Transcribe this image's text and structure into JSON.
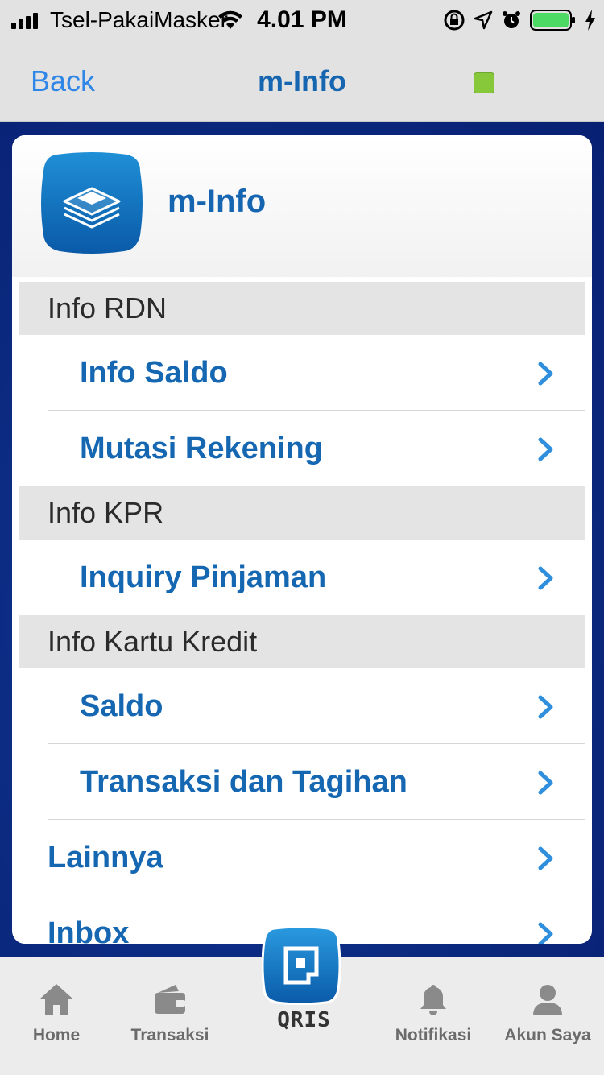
{
  "status_bar": {
    "carrier": "Tsel-PakaiMasker",
    "time": "4.01 PM"
  },
  "nav": {
    "back_label": "Back",
    "title": "m-Info",
    "indicator_color": "#86c83a"
  },
  "card": {
    "icon": "document-stack-icon",
    "title": "m-Info"
  },
  "sections": [
    {
      "header": "Info RDN",
      "items": [
        {
          "label": "Info Saldo"
        },
        {
          "label": "Mutasi Rekening"
        }
      ]
    },
    {
      "header": "Info KPR",
      "items": [
        {
          "label": "Inquiry Pinjaman"
        }
      ]
    },
    {
      "header": "Info Kartu Kredit",
      "items": [
        {
          "label": "Saldo"
        },
        {
          "label": "Transaksi dan Tagihan"
        }
      ]
    }
  ],
  "top_items": [
    {
      "label": "Lainnya"
    },
    {
      "label": "Inbox"
    }
  ],
  "tabbar": {
    "items": [
      {
        "label": "Home",
        "icon": "home-icon"
      },
      {
        "label": "Transaksi",
        "icon": "wallet-icon"
      },
      {
        "label": "QRIS",
        "icon": "qris-icon"
      },
      {
        "label": "Notifikasi",
        "icon": "bell-icon"
      },
      {
        "label": "Akun Saya",
        "icon": "user-icon"
      }
    ]
  },
  "colors": {
    "accent_blue": "#1565b0",
    "link_blue": "#2f86e6",
    "background_navy": "#0b2a80"
  }
}
